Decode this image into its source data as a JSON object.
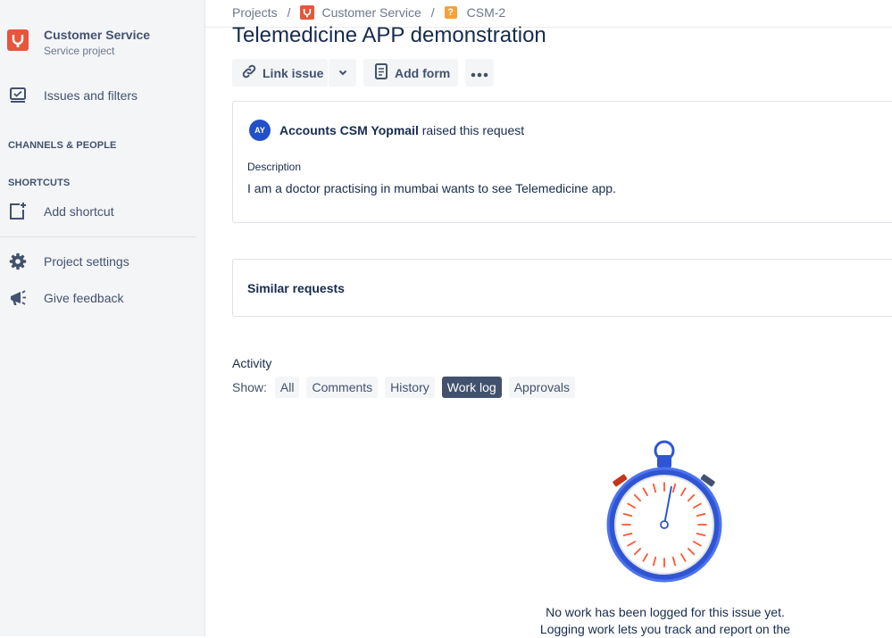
{
  "sidebar": {
    "project_name": "Customer Service",
    "project_type": "Service project",
    "issues_filters": "Issues and filters",
    "channels_people": "CHANNELS & PEOPLE",
    "shortcuts": "SHORTCUTS",
    "add_shortcut": "Add shortcut",
    "project_settings": "Project settings",
    "give_feedback": "Give feedback"
  },
  "breadcrumb": {
    "projects": "Projects",
    "sep": "/",
    "project": "Customer Service",
    "issue_key": "CSM-2",
    "issue_icon_glyph": "?"
  },
  "issue": {
    "title": "Telemedicine APP demonstration",
    "link_issue": "Link issue",
    "add_form": "Add form",
    "reporter_initials": "AY",
    "reporter_name": "Accounts CSM Yopmail",
    "raised_suffix": "raised this request",
    "description_label": "Description",
    "description_text": "I am a doctor practising in mumbai wants to see Telemedicine app.",
    "similar_requests": "Similar requests"
  },
  "activity": {
    "heading": "Activity",
    "show_label": "Show:",
    "filters": [
      "All",
      "Comments",
      "History",
      "Work log",
      "Approvals"
    ],
    "active_filter": "Work log",
    "empty_line1": "No work has been logged for this issue yet.",
    "empty_line2": "Logging work lets you track and report on the"
  },
  "colors": {
    "brand_red": "#e5563b",
    "issue_orange": "#f6a13a",
    "avatar_blue": "#2250c7",
    "active_chip": "#42526e"
  },
  "icons": {
    "issues": "issues-icon",
    "add_shortcut": "add-shortcut-icon",
    "settings": "gear-icon",
    "feedback": "megaphone-icon",
    "link": "link-icon",
    "chevron": "chevron-down-icon",
    "form": "form-icon",
    "more": "more-icon",
    "timer": "stopwatch-illustration"
  }
}
